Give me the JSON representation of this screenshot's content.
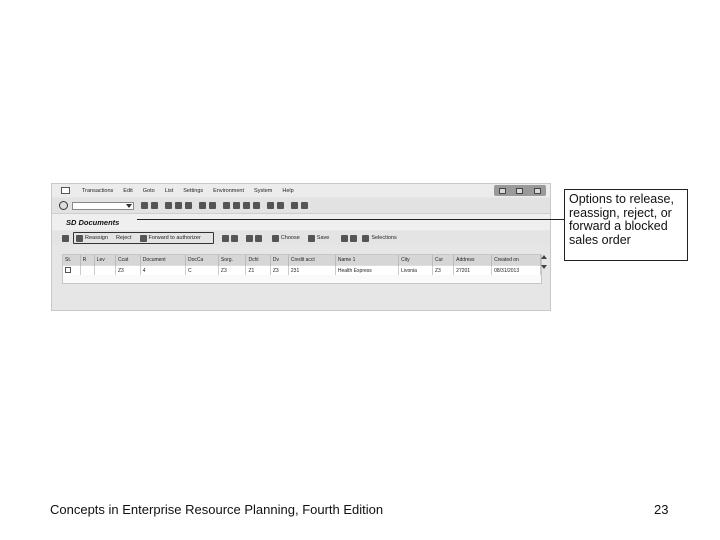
{
  "menu": [
    "Transactions",
    "Edit",
    "Goto",
    "List",
    "Settings",
    "Environment",
    "System",
    "Help"
  ],
  "window_title": "SD Documents",
  "app_toolbar": {
    "reassign": "Reassign",
    "reject": "Reject",
    "forward": "Forward to authorizer",
    "choose": "Choose",
    "save": "Save",
    "selections": "Selections"
  },
  "table": {
    "headers": [
      "St.",
      "R",
      "Lev",
      "Ccat",
      "Document",
      "DocCa",
      "Sorg.",
      "Dchl",
      "Dv",
      "Credit acct",
      "Name 1",
      "City",
      "Cur",
      "Address",
      "Created on"
    ],
    "rows": [
      [
        "✓",
        "",
        "",
        "Z3",
        "4",
        "C",
        "Z3",
        "Z1",
        "Z3",
        "231",
        "Health Express",
        "Livonia",
        "Z3",
        "27201",
        "08/31/2013"
      ]
    ]
  },
  "callout": "Options to release, reassign, reject, or forward a blocked sales order",
  "footer": {
    "title": "Concepts in Enterprise Resource Planning, Fourth Edition",
    "page": "23"
  }
}
